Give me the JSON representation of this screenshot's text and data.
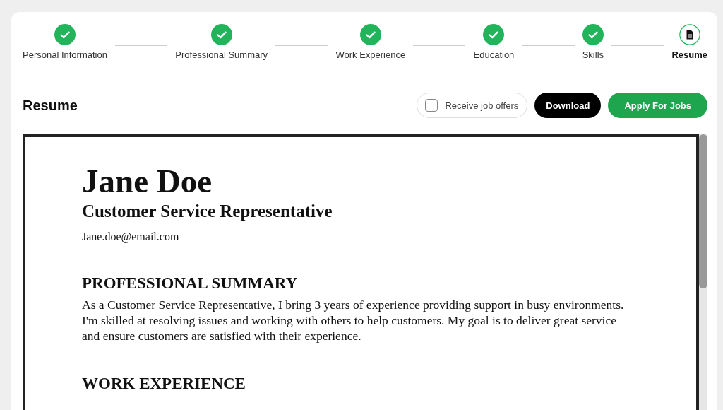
{
  "steps": [
    {
      "label": "Personal Information",
      "completed": true,
      "selected": false
    },
    {
      "label": "Professional Summary",
      "completed": true,
      "selected": false
    },
    {
      "label": "Work Experience",
      "completed": true,
      "selected": false
    },
    {
      "label": "Education",
      "completed": true,
      "selected": false
    },
    {
      "label": "Skills",
      "completed": true,
      "selected": false
    },
    {
      "label": "Resume",
      "completed": false,
      "selected": true
    }
  ],
  "header": {
    "title": "Resume",
    "job_offers": {
      "label": "Receive job offers",
      "checked": false
    },
    "buttons": [
      "Download",
      "Apply For Jobs"
    ]
  },
  "resume": {
    "name": "Jane Doe",
    "job_title": "Customer Service Representative",
    "email": "Jane.doe@email.com",
    "sections": [
      {
        "heading": "PROFESSIONAL SUMMARY",
        "text": "As a Customer Service Representative, I bring 3 years of experience providing support in busy environments. I'm skilled at resolving issues and working with others to help customers. My goal is to deliver great service and ensure customers are satisfied with their experience."
      },
      {
        "heading": "WORK EXPERIENCE"
      }
    ]
  }
}
